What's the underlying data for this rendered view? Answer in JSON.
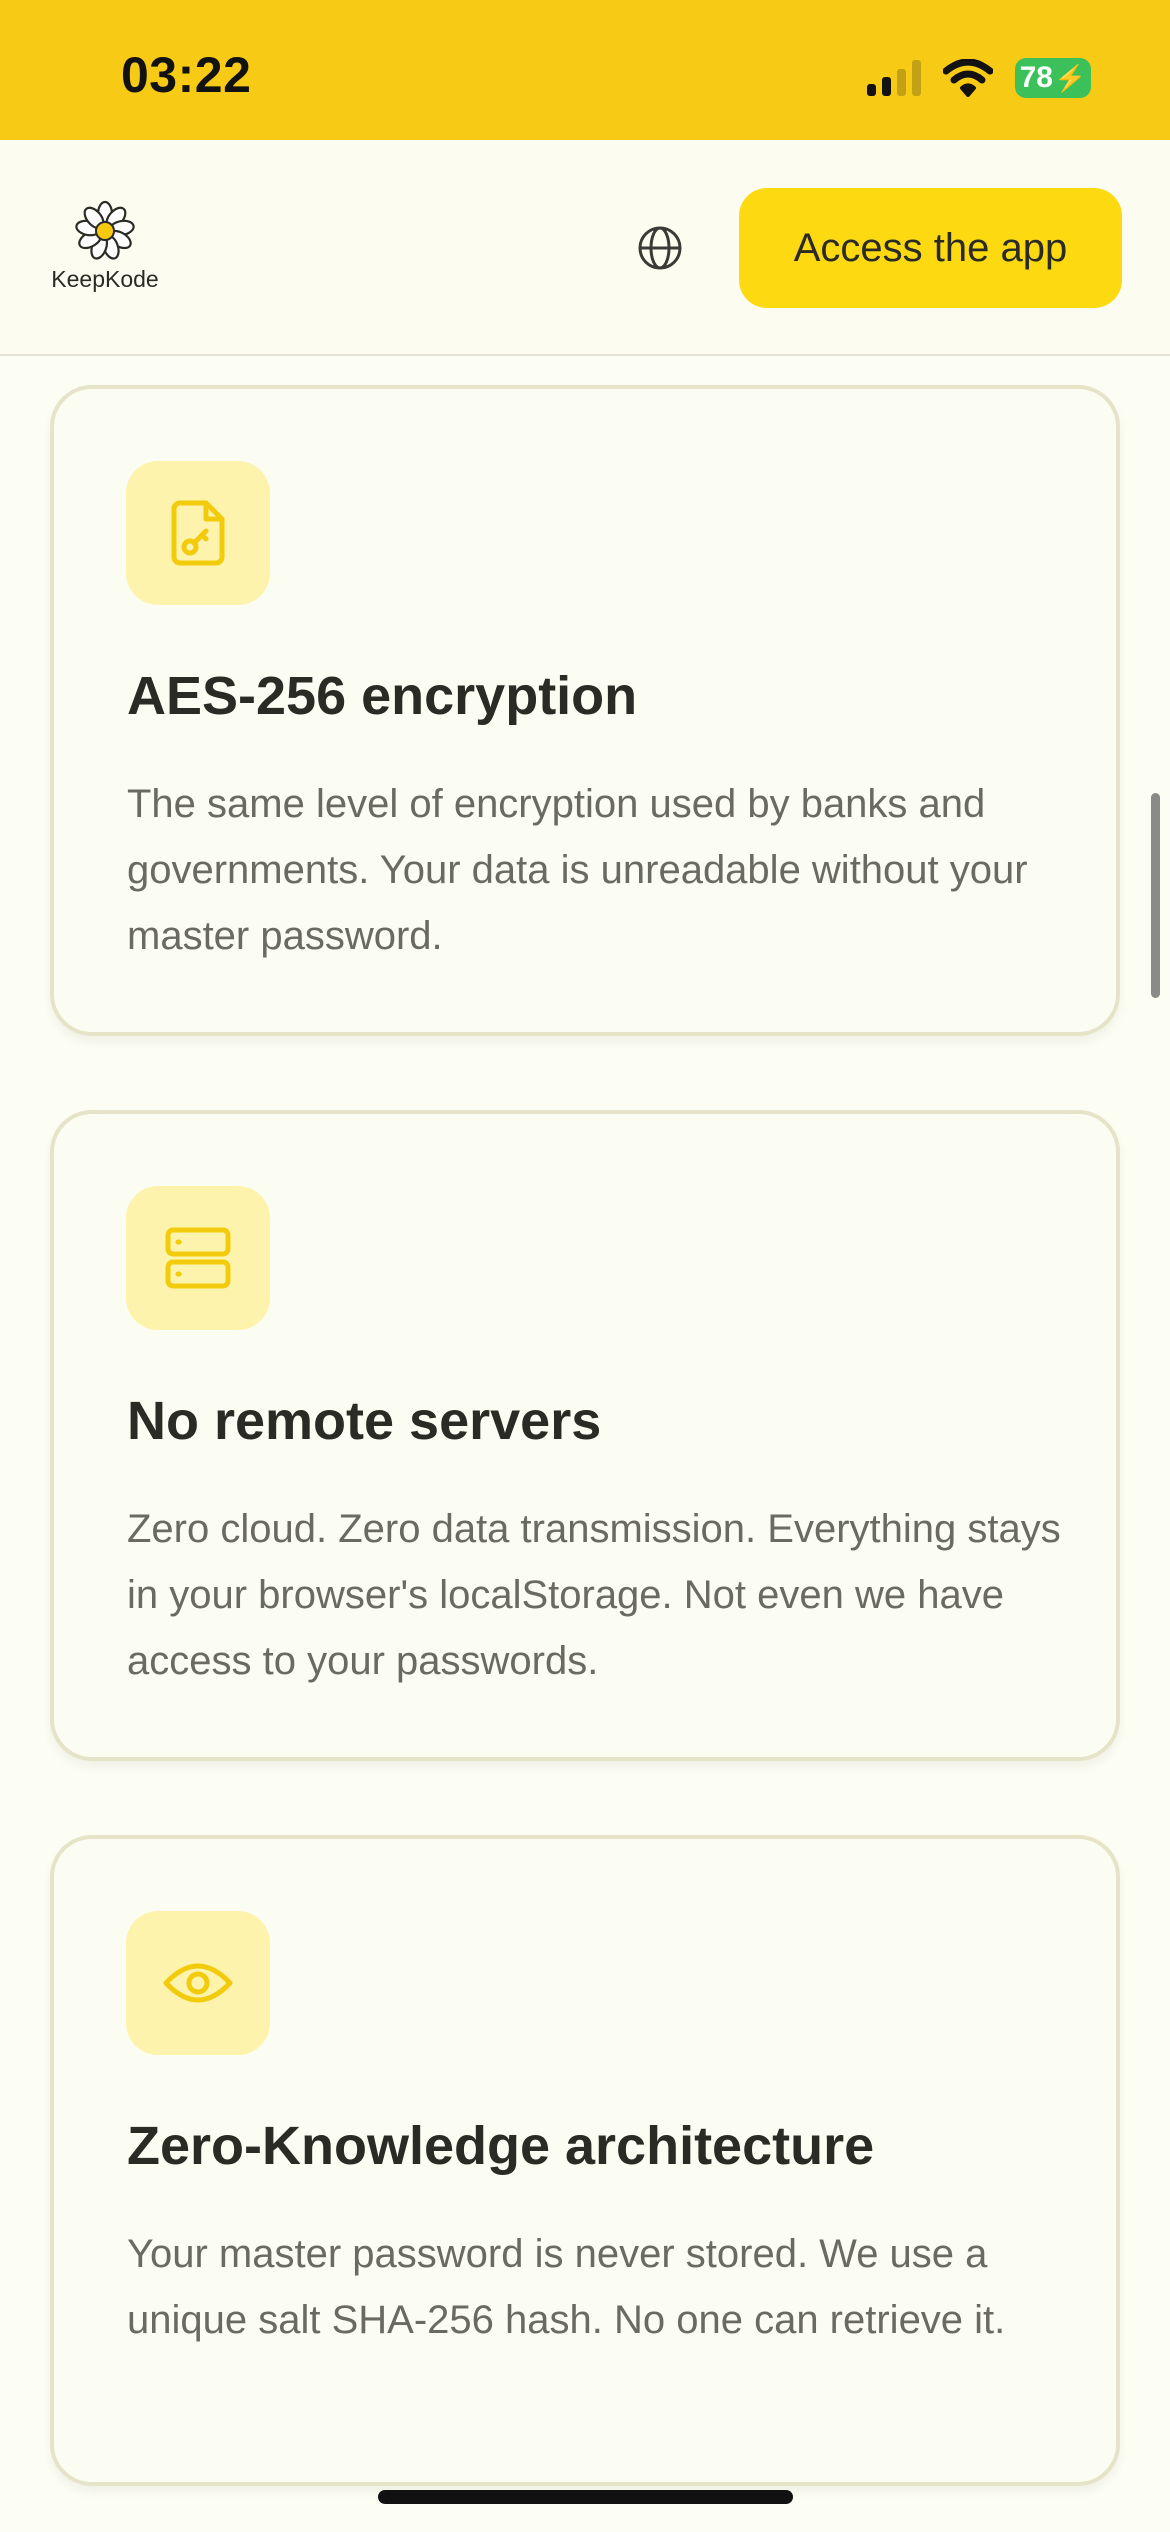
{
  "status_bar": {
    "time": "03:22",
    "battery_level": "78",
    "icons": [
      "signal-icon",
      "wifi-icon",
      "battery-charging-icon"
    ]
  },
  "header": {
    "logo_text": "KeepKode",
    "logo_icon": "daisy-flower-icon",
    "language_icon": "globe-icon",
    "cta_label": "Access the app"
  },
  "features": [
    {
      "icon": "file-key-icon",
      "title": "AES-256 encryption",
      "description": "The same level of encryption used by banks and governments. Your data is unreadable without your master password."
    },
    {
      "icon": "server-icon",
      "title": "No remote servers",
      "description": "Zero cloud. Zero data transmission. Everything stays in your browser's localStorage. Not even we have access to your passwords."
    },
    {
      "icon": "eye-icon",
      "title": "Zero-Knowledge architecture",
      "description": "Your master password is never stored. We use a unique salt SHA-256 hash. No one can retrieve it."
    }
  ],
  "colors": {
    "status_bar_bg": "#f7cb15",
    "accent_yellow": "#fcd910",
    "icon_tile_bg": "#fdf3ad",
    "icon_stroke": "#f2cb0c",
    "page_bg": "#fcfdf3",
    "card_border": "#e5e3c8",
    "title_text": "#2b2b26",
    "body_text": "#6a6a62"
  }
}
